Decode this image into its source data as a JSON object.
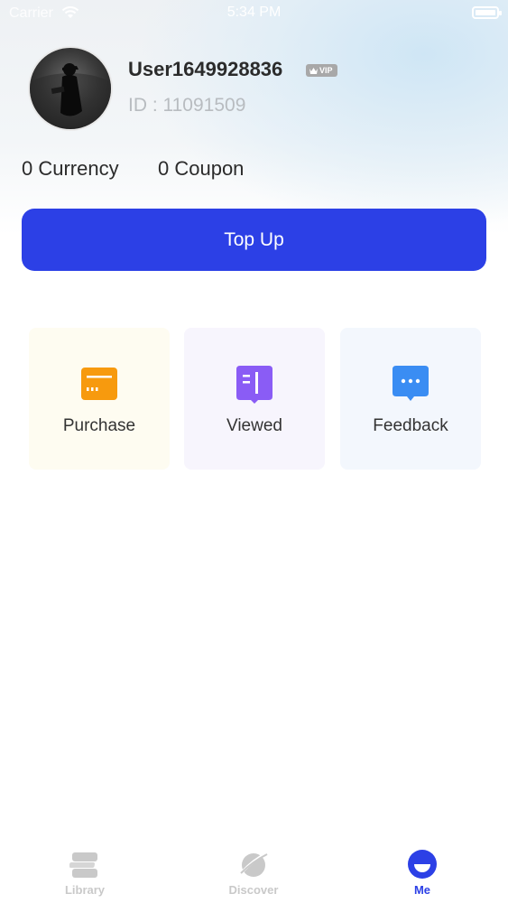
{
  "status_bar": {
    "carrier": "Carrier",
    "time": "5:34 PM",
    "battery_level": 1.0
  },
  "profile": {
    "username": "User1649928836",
    "vip_badge": "VIP",
    "user_id": "ID : 11091509",
    "currency": "0 Currency",
    "coupon": "0 Coupon"
  },
  "top_up": {
    "label": "Top Up",
    "color": "#2c40e6"
  },
  "quick_actions": [
    {
      "label": "Purchase",
      "icon": "wallet-icon",
      "color": "#f79a0e"
    },
    {
      "label": "Viewed",
      "icon": "book-icon",
      "color": "#8a5cf5"
    },
    {
      "label": "Feedback",
      "icon": "chat-icon",
      "color": "#3a8df3"
    }
  ],
  "tab_bar": {
    "active": "Me",
    "tabs": [
      {
        "label": "Library",
        "icon": "library-icon"
      },
      {
        "label": "Discover",
        "icon": "planet-icon"
      },
      {
        "label": "Me",
        "icon": "profile-icon"
      }
    ]
  }
}
